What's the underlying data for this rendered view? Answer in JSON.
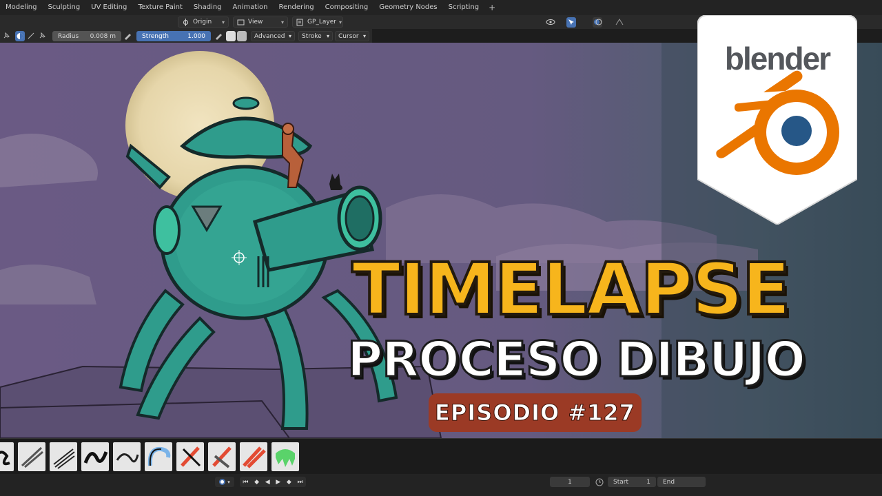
{
  "workspace_tabs": [
    "Modeling",
    "Sculpting",
    "UV Editing",
    "Texture Paint",
    "Shading",
    "Animation",
    "Rendering",
    "Compositing",
    "Geometry Nodes",
    "Scripting"
  ],
  "header": {
    "origin_label": "Origin",
    "view_label": "View",
    "layer_label": "GP_Layer"
  },
  "tool_settings": {
    "radius_label": "Radius",
    "radius_value": "0.008 m",
    "strength_label": "Strength",
    "strength_value": "1.000",
    "advanced_label": "Advanced",
    "stroke_label": "Stroke",
    "cursor_label": "Cursor"
  },
  "overlay": {
    "title_line1": "TIMELAPSE",
    "title_line2": "PROCESO DIBUJO",
    "episode": "EPISODIO #127",
    "logo_text": "blender"
  },
  "timeline": {
    "current_frame": "1",
    "start_label": "Start",
    "start_value": "1",
    "end_label": "End"
  },
  "colors": {
    "accent_blue": "#4772b3",
    "title_yellow": "#f7b51c",
    "episode_red": "#9b3a25",
    "blender_orange": "#ea7600",
    "blender_blue": "#265787",
    "sky_purple": "#68567f",
    "robot_teal": "#2f9c8c"
  },
  "icons": [
    "pin-icon",
    "sphere-icon",
    "origin-icon",
    "view-icon",
    "layer-icon",
    "eye-icon",
    "cursor-icon",
    "overlay-icon",
    "record-icon",
    "play-icon",
    "jump-start-icon",
    "jump-end-icon",
    "clock-icon"
  ]
}
